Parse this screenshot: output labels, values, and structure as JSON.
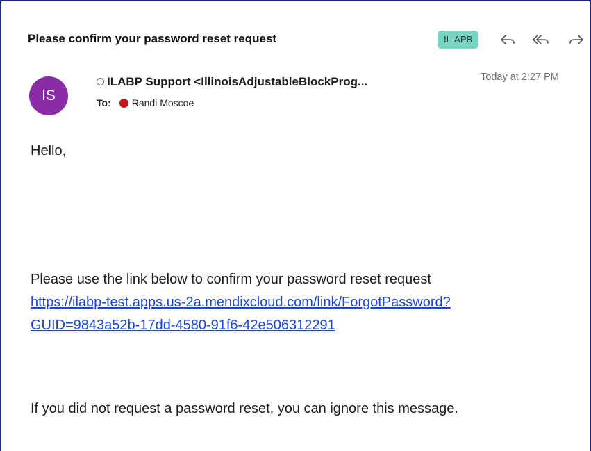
{
  "email": {
    "subject": "Please confirm your password reset request",
    "tag": "IL-APB",
    "sender_initials": "IS",
    "sender": "ILABP Support <IllinoisAdjustableBlockProg...",
    "timestamp": "Today at 2:27 PM",
    "to_label": "To:",
    "recipient": "Randi Moscoe"
  },
  "actions": {
    "reply_icon": "reply-icon",
    "reply_all_icon": "reply-all-icon",
    "forward_icon": "forward-icon"
  },
  "body": {
    "greeting": "Hello,",
    "instruction": "Please use the link below to confirm your password reset request",
    "link_line1": "https://ilabp-test.apps.us-2a.mendixcloud.com/link/ForgotPassword?",
    "link_line2": "GUID=9843a52b-17dd-4580-91f6-42e506312291",
    "footer": "If you did not request a password reset, you can ignore this message."
  },
  "colors": {
    "border": "#1f2a6b",
    "tag_bg": "#79d4c2",
    "avatar_bg": "#8a2ca6",
    "link": "#1a44d4",
    "recipient_dot": "#c4161c"
  }
}
